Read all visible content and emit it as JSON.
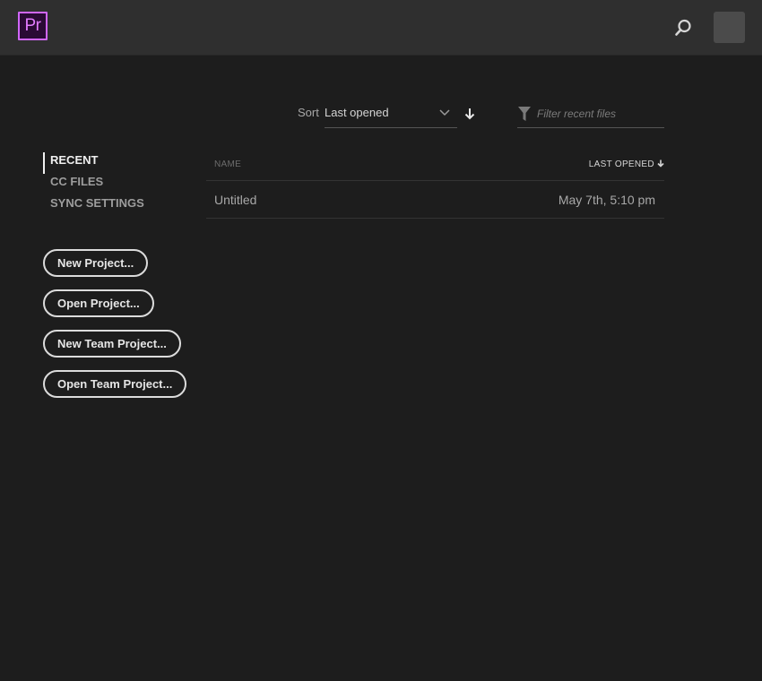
{
  "app": {
    "logo_text": "Pr",
    "accent_color": "#d166ff"
  },
  "header": {
    "search_icon": "search-icon",
    "avatar": "user-avatar"
  },
  "sort": {
    "label": "Sort",
    "selected": "Last opened",
    "direction": "descending"
  },
  "filter": {
    "placeholder": "Filter recent files",
    "value": ""
  },
  "sidebar": {
    "items": [
      {
        "label": "RECENT",
        "active": true
      },
      {
        "label": "CC FILES",
        "active": false
      },
      {
        "label": "SYNC SETTINGS",
        "active": false
      }
    ]
  },
  "actions": [
    {
      "label": "New Project..."
    },
    {
      "label": "Open Project..."
    },
    {
      "label": "New Team Project..."
    },
    {
      "label": "Open Team Project..."
    }
  ],
  "table": {
    "columns": {
      "name": "NAME",
      "last_opened": "LAST OPENED"
    },
    "rows": [
      {
        "name": "Untitled",
        "last_opened": "May 7th, 5:10 pm"
      }
    ]
  }
}
